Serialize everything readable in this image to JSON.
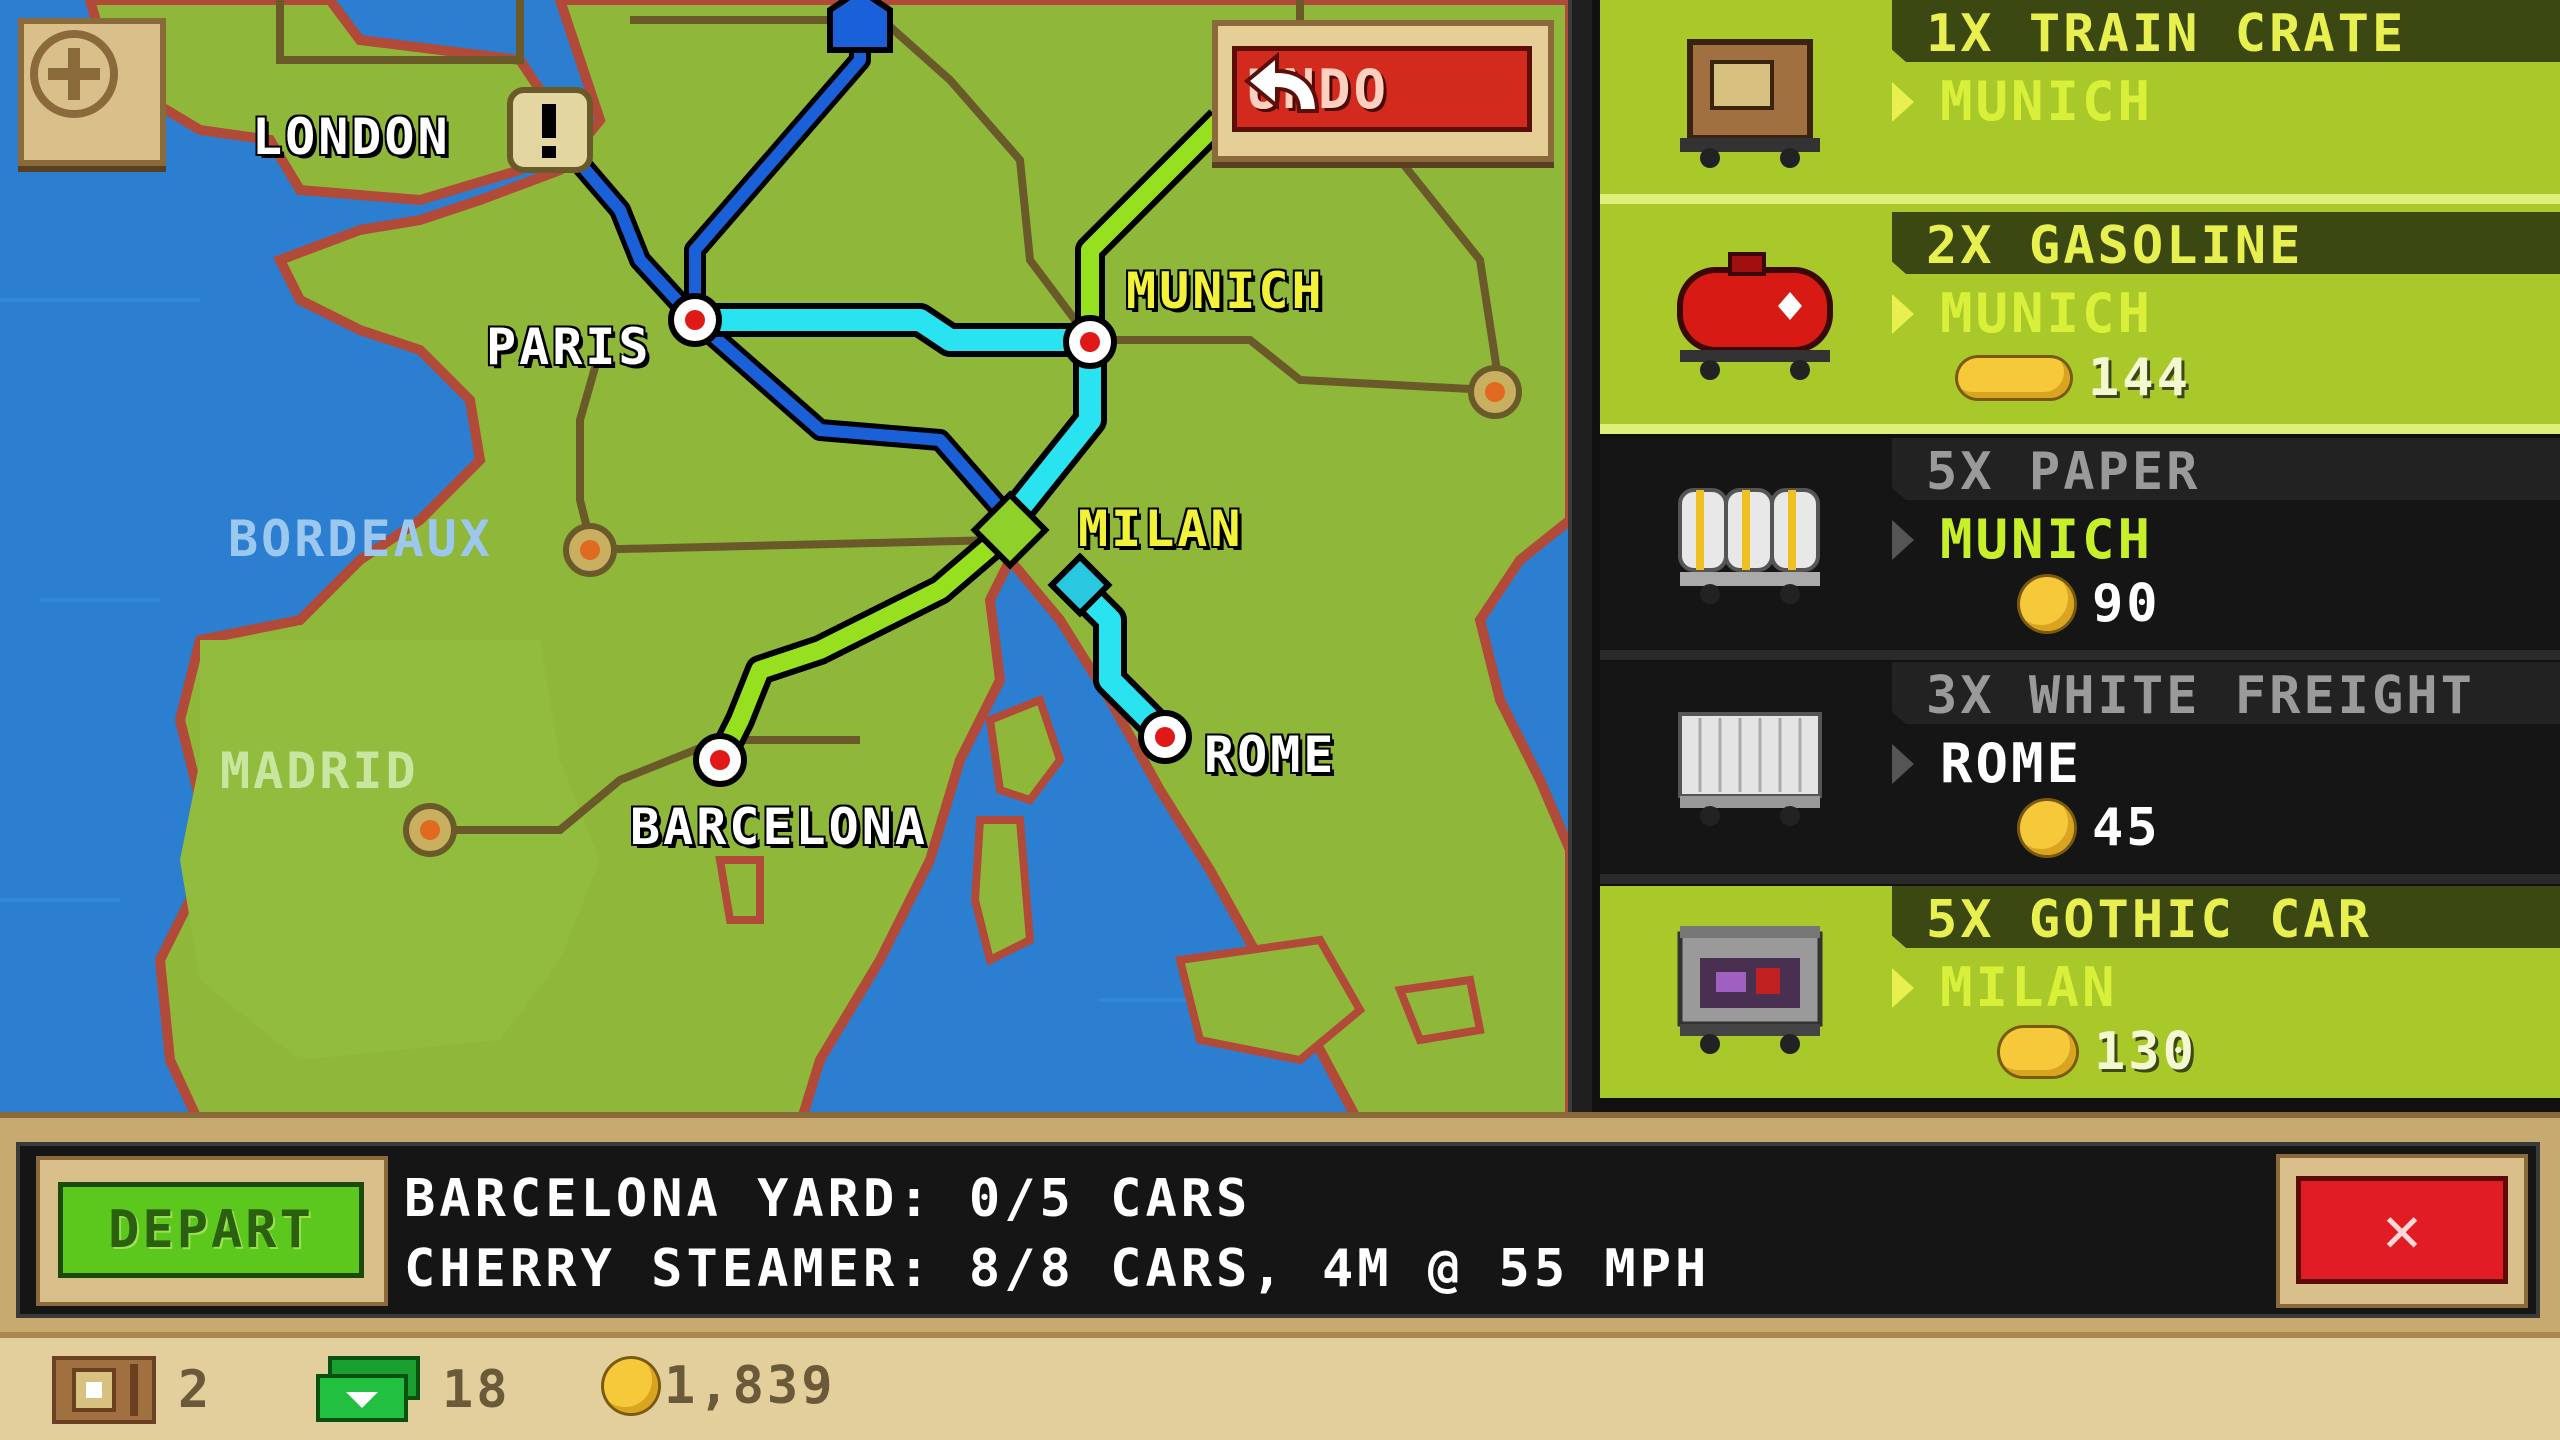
{
  "map": {
    "cities": [
      {
        "name": "LONDON",
        "style": "white"
      },
      {
        "name": "PARIS",
        "style": "white"
      },
      {
        "name": "MUNICH",
        "style": "yellow"
      },
      {
        "name": "MILAN",
        "style": "yellow"
      },
      {
        "name": "BORDEAUX",
        "style": "blue"
      },
      {
        "name": "MADRID",
        "style": "green"
      },
      {
        "name": "BARCELONA",
        "style": "white"
      },
      {
        "name": "ROME",
        "style": "white"
      }
    ],
    "alert_icon": "exclamation-icon",
    "add_icon": "plus-icon"
  },
  "undo_button": {
    "label": "UNDO",
    "icon": "undo-arrow-icon"
  },
  "cargo": [
    {
      "title": "1X TRAIN CRATE",
      "destination": "MUNICH",
      "reward": "",
      "state": "active",
      "icon": "crate-car-icon",
      "coin_icon": ""
    },
    {
      "title": "2X GASOLINE",
      "destination": "MUNICH",
      "reward": "144",
      "state": "active",
      "icon": "tanker-car-icon",
      "coin_icon": "coin-stack-icon"
    },
    {
      "title": "5X PAPER",
      "destination": "MUNICH",
      "reward": "90",
      "state": "inactive",
      "icon": "paper-car-icon",
      "coin_icon": "coin-icon"
    },
    {
      "title": "3X WHITE FREIGHT",
      "destination": "ROME",
      "reward": "45",
      "state": "inactive",
      "icon": "freight-car-icon",
      "coin_icon": "coin-icon"
    },
    {
      "title": "5X GOTHIC CAR",
      "destination": "MILAN",
      "reward": "130",
      "state": "active",
      "icon": "gothic-car-icon",
      "coin_icon": "coin-pile-icon"
    }
  ],
  "info": {
    "depart_label": "DEPART",
    "line1": "BARCELONA YARD: 0/5 CARS",
    "line2": "CHERRY STEAMER: 8/8 CARS, 4M @ 55 MPH",
    "close_label": "✕"
  },
  "status": {
    "crates": "2",
    "cash": "18",
    "coins": "1,839",
    "crate_icon": "crate-icon",
    "cash_icon": "cash-icon",
    "coin_icon": "coin-icon"
  },
  "colors": {
    "sea": "#2c7fd0",
    "land": "#8fb83a",
    "route_cyan": "#29e3f0",
    "route_blue": "#1a60d8",
    "route_green": "#96e020",
    "active_row": "#a9c92a"
  }
}
